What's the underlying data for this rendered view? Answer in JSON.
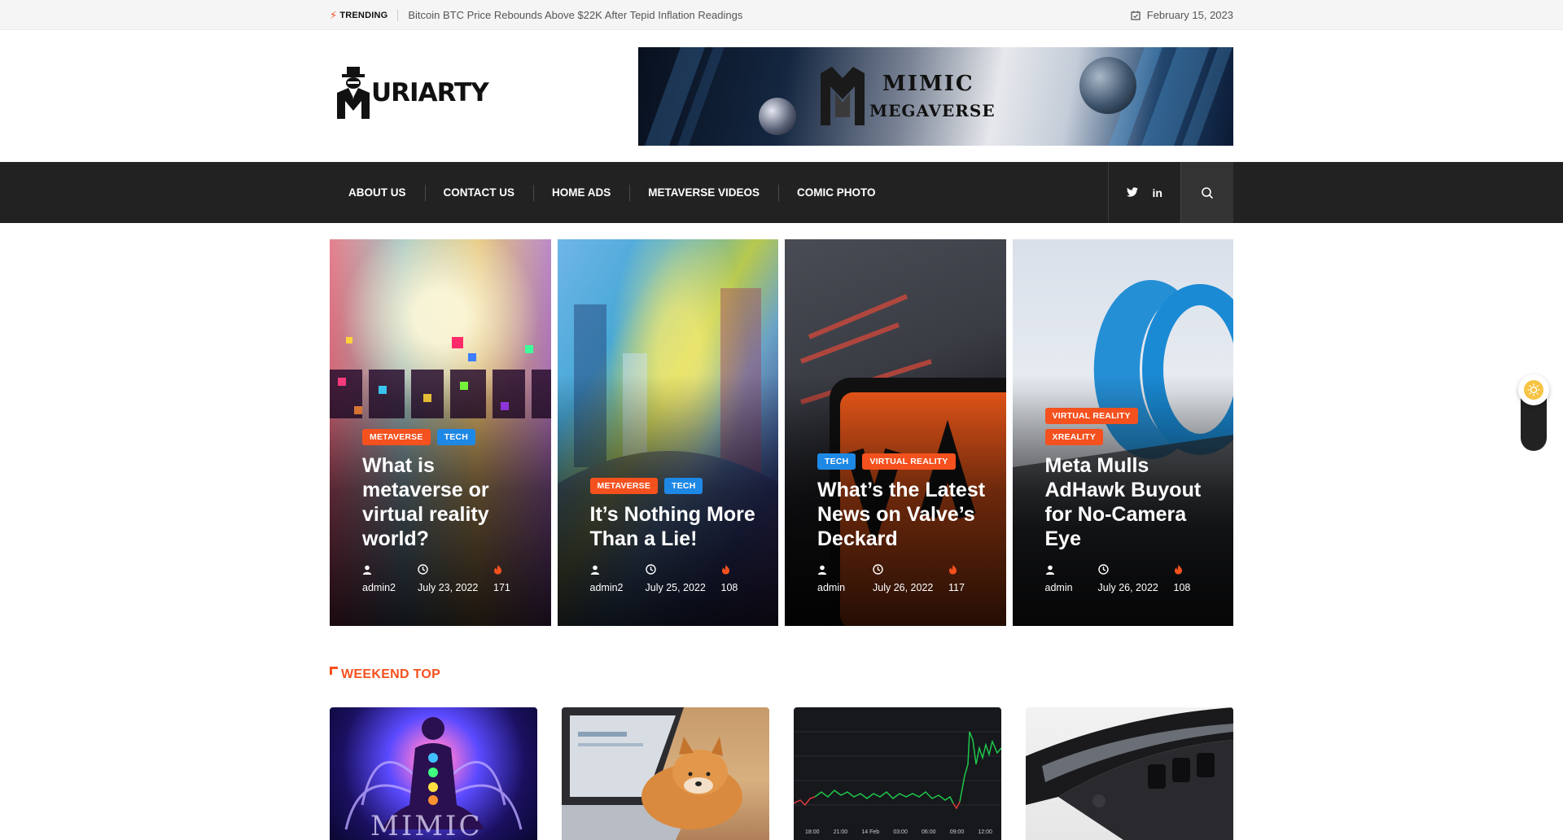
{
  "topbar": {
    "trending_label": "TRENDING",
    "trending_headline": "Bitcoin BTC Price Rebounds Above $22K After Tepid Inflation Readings",
    "date": "February 15, 2023"
  },
  "header": {
    "logo_text": "URIARTY",
    "banner": {
      "line1": "MIMIC",
      "line2": "MEGAVERSE"
    }
  },
  "nav": {
    "items": [
      "ABOUT US",
      "CONTACT US",
      "HOME ADS",
      "METAVERSE VIDEOS",
      "COMIC PHOTO"
    ],
    "social": [
      {
        "icon": "twitter-icon"
      },
      {
        "icon": "linkedin-icon",
        "label": "in"
      }
    ],
    "search_icon": "search-icon"
  },
  "features": [
    {
      "tags": [
        "METAVERSE",
        "TECH"
      ],
      "title": "What is metaverse or virtual reality world?",
      "author": "admin2",
      "date": "July 23, 2022",
      "views": "171"
    },
    {
      "tags": [
        "METAVERSE",
        "TECH"
      ],
      "title": "It’s Nothing More Than a Lie!",
      "author": "admin2",
      "date": "July 25, 2022",
      "views": "108"
    },
    {
      "tags": [
        "TECH",
        "VIRTUAL REALITY"
      ],
      "title": "What’s the Latest News on Valve’s Deckard",
      "author": "admin",
      "date": "July 26, 2022",
      "views": "117"
    },
    {
      "tags": [
        "VIRTUAL REALITY",
        "XREALITY"
      ],
      "title": "Meta Mulls AdHawk Buyout for No-Camera Eye",
      "author": "admin",
      "date": "July 26, 2022",
      "views": "108"
    }
  ],
  "section": {
    "title": "WEEKEND TOP"
  },
  "weekend": {
    "image1_caption": "MIMIC",
    "chart_ticks": [
      "18:00",
      "21:00",
      "14 Feb",
      "03:00",
      "06:00",
      "09:00",
      "12:00"
    ]
  },
  "colors": {
    "accent": "#f4511e",
    "tag_blue": "#1e88e5",
    "nav_bg": "#222222"
  }
}
